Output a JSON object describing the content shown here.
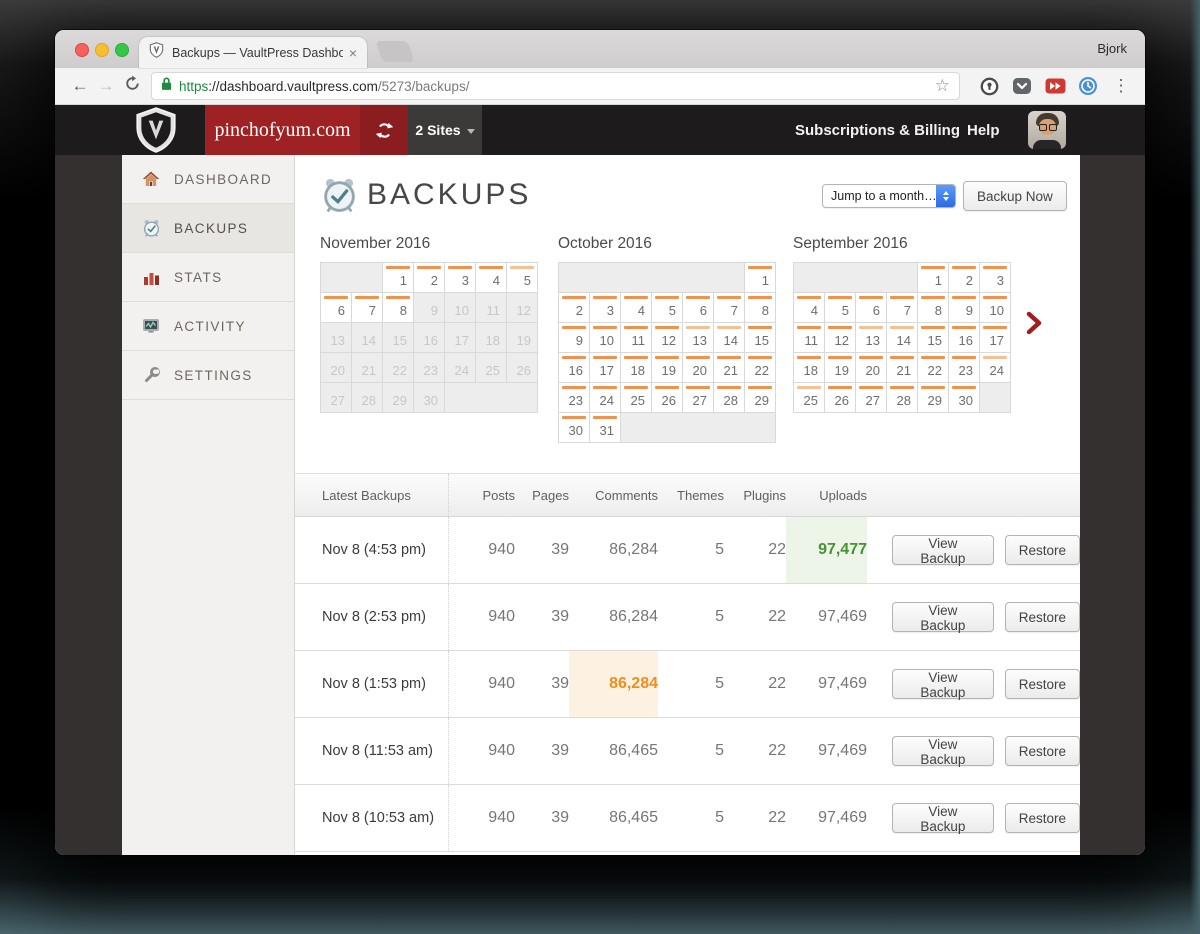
{
  "browser": {
    "profile": "Bjork",
    "tab": {
      "title": "Backups — VaultPress Dashbo",
      "close_glyph": "×",
      "favicon": "vaultpress-shield-icon"
    },
    "url": {
      "scheme": "https",
      "host": "://dashboard.vaultpress.com",
      "path": "/5273/backups/"
    },
    "toolbar_icons": [
      "back-arrow-icon",
      "forward-arrow-icon",
      "refresh-icon",
      "lock-icon",
      "star-icon",
      "onepassword-icon",
      "pocket-icon",
      "fastforward-icon",
      "history-clock-icon",
      "menu-dots-icon"
    ],
    "menu_dots_glyph": "⋮",
    "star_glyph": "☆",
    "back_glyph": "←",
    "forward_glyph": "→"
  },
  "nav": {
    "logo": "vaultpress-shield-icon",
    "site_name": "pinchofyum.com",
    "sites_count_label": "2 Sites",
    "billing_label": "Subscriptions & Billing",
    "help_label": "Help",
    "avatar": "user-avatar"
  },
  "sidebar": {
    "items": [
      {
        "label": "DASHBOARD",
        "icon": "home-icon",
        "active": false
      },
      {
        "label": "BACKUPS",
        "icon": "alarm-clock-icon",
        "active": true
      },
      {
        "label": "STATS",
        "icon": "bar-chart-icon",
        "active": false
      },
      {
        "label": "ACTIVITY",
        "icon": "activity-monitor-icon",
        "active": false
      },
      {
        "label": "SETTINGS",
        "icon": "wrench-icon",
        "active": false
      }
    ]
  },
  "header": {
    "icon": "alarm-clock-icon",
    "title": "BACKUPS",
    "month_select_label": "Jump to a month…",
    "backup_now_label": "Backup Now"
  },
  "calendars": [
    {
      "title": "November 2016",
      "leading_empty": 2,
      "days_in_month": 30,
      "backed_up_days": [
        1,
        2,
        3,
        4,
        5,
        6,
        7,
        8
      ],
      "faded_days": [
        5
      ]
    },
    {
      "title": "October 2016",
      "leading_empty": 6,
      "days_in_month": 31,
      "backed_up_days": [
        1,
        2,
        3,
        4,
        5,
        6,
        7,
        8,
        9,
        10,
        11,
        12,
        13,
        14,
        15,
        16,
        17,
        18,
        19,
        20,
        21,
        22,
        23,
        24,
        25,
        26,
        27,
        28,
        29,
        30,
        31
      ],
      "faded_days": [
        13,
        14
      ]
    },
    {
      "title": "September 2016",
      "leading_empty": 4,
      "days_in_month": 30,
      "backed_up_days": [
        1,
        2,
        3,
        4,
        5,
        6,
        7,
        8,
        9,
        10,
        11,
        12,
        13,
        14,
        15,
        16,
        17,
        18,
        19,
        20,
        21,
        22,
        23,
        24,
        25,
        26,
        27,
        28,
        29,
        30
      ],
      "faded_days": [
        13,
        14,
        24,
        25
      ]
    }
  ],
  "table": {
    "header": {
      "latest": "Latest Backups",
      "columns": [
        "Posts",
        "Pages",
        "Comments",
        "Themes",
        "Plugins",
        "Uploads"
      ]
    },
    "actions": [
      "View Backup",
      "Restore"
    ],
    "rows": [
      {
        "date": "Nov 8 (4:53 pm)",
        "posts": "940",
        "pages": "39",
        "comments": "86,284",
        "themes": "5",
        "plugins": "22",
        "uploads": "97,477",
        "highlight": "uploads-green"
      },
      {
        "date": "Nov 8 (2:53 pm)",
        "posts": "940",
        "pages": "39",
        "comments": "86,284",
        "themes": "5",
        "plugins": "22",
        "uploads": "97,469",
        "highlight": null
      },
      {
        "date": "Nov 8 (1:53 pm)",
        "posts": "940",
        "pages": "39",
        "comments": "86,284",
        "themes": "5",
        "plugins": "22",
        "uploads": "97,469",
        "highlight": "comments-orange"
      },
      {
        "date": "Nov 8 (11:53 am)",
        "posts": "940",
        "pages": "39",
        "comments": "86,465",
        "themes": "5",
        "plugins": "22",
        "uploads": "97,469",
        "highlight": null
      },
      {
        "date": "Nov 8 (10:53 am)",
        "posts": "940",
        "pages": "39",
        "comments": "86,465",
        "themes": "5",
        "plugins": "22",
        "uploads": "97,469",
        "highlight": null
      }
    ]
  },
  "colors": {
    "accent_red": "#9e2224",
    "sync_red": "#8b1c1f",
    "nav_black": "#1d1b1b",
    "backup_bar_orange": "#f0924f",
    "backup_bar_faded": "#f6c096",
    "green_text": "#479233",
    "green_bg": "#edf5e8",
    "orange_text": "#ef8e1d",
    "orange_bg": "#fdf2e1",
    "chevron_red": "#a31d1d"
  }
}
